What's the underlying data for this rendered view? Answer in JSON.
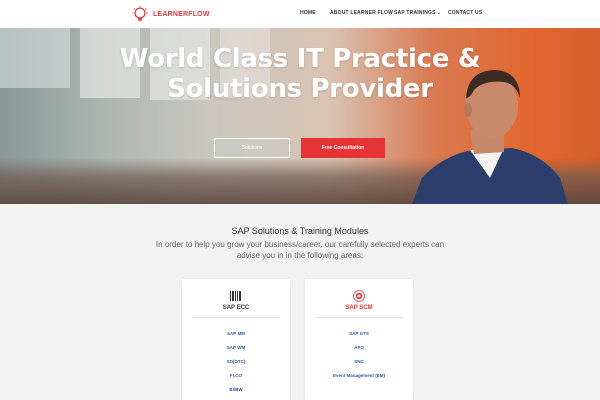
{
  "brand": {
    "name": "LEARNERFLOW",
    "accent": "#e23b3b"
  },
  "nav": {
    "items": [
      {
        "label": "HOME"
      },
      {
        "label": "ABOUT LEARNER FLOW"
      },
      {
        "label": "SAP TRAININGS"
      },
      {
        "label": "CONTACT US"
      }
    ]
  },
  "hero": {
    "title_line1": "World Class IT Practice &",
    "title_line2": "Solutions Provider",
    "btn_solutions": "Solutions",
    "btn_consult": "Free Consultation"
  },
  "section": {
    "title": "SAP Solutions & Training Modules",
    "subtitle": "In order to help you grow your business/career, our carefully selected experts can advise you in in the following areas:"
  },
  "cards": [
    {
      "title": "SAP ECC",
      "icon": "barcode-icon",
      "color": "#333333",
      "links": [
        "SAP MM",
        "SAP WM",
        "SD(OTC)",
        "FI.CO",
        "BI/BW"
      ]
    },
    {
      "title": "SAP SCM",
      "icon": "target-icon",
      "color": "#e23b3b",
      "links": [
        "SAP GTS",
        "APO",
        "SNC",
        "Event Management (EM)"
      ]
    }
  ]
}
